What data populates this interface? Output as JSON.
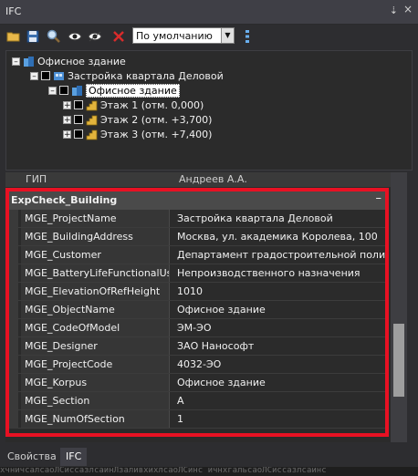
{
  "window": {
    "title": "IFC",
    "pin_glyph": "⇣",
    "close_glyph": "×"
  },
  "toolbar": {
    "buttons": [
      "open-icon",
      "save-icon",
      "search-icon",
      "eye-icon",
      "eye-icon",
      "delete-icon"
    ],
    "view_mode": "По умолчанию"
  },
  "tree": {
    "root": "Офисное здание",
    "project": "Застройка квартала Деловой",
    "building": "Офисное здание",
    "floors": [
      "Этаж 1 (отм. 0,000)",
      "Этаж 2 (отм. +3,700)",
      "Этаж 3 (отм. +7,400)"
    ]
  },
  "properties": {
    "prev_row": {
      "key": "ГИП",
      "value": "Андреев А.А."
    },
    "category": "ExpCheck_Building",
    "collapse_glyph": "–",
    "rows": [
      {
        "key": "MGE_ProjectName",
        "value": "Застройка квартала Деловой"
      },
      {
        "key": "MGE_BuildingAddress",
        "value": "Москва, ул. академика Королева, 100"
      },
      {
        "key": "MGE_Customer",
        "value": "Департамент градостроительной политики г"
      },
      {
        "key": "MGE_BatteryLifeFunctionalUse",
        "value": "Непроизводственного назначения"
      },
      {
        "key": "MGE_ElevationOfRefHeight",
        "value": "1010"
      },
      {
        "key": "MGE_ObjectName",
        "value": "Офисное здание"
      },
      {
        "key": "MGE_CodeOfModel",
        "value": "ЭМ-ЭО"
      },
      {
        "key": "MGE_Designer",
        "value": "ЗАО Нанософт"
      },
      {
        "key": "MGE_ProjectCode",
        "value": "4032-ЭО"
      },
      {
        "key": "MGE_Korpus",
        "value": "Офисное здание"
      },
      {
        "key": "MGE_Section",
        "value": "A"
      },
      {
        "key": "MGE_NumOfSection",
        "value": "1"
      }
    ]
  },
  "tabs": [
    {
      "label": "Свойства",
      "active": false
    },
    {
      "label": "IFC",
      "active": true
    }
  ],
  "bottom_strip": "хчничсалсаоЛСиссазлсаинЛзаливхихлсаоЛСинс ичнхгальсаоЛСиссазлсаинс",
  "colors": {
    "highlight_border": "#e81123",
    "background": "#2d2d30"
  }
}
